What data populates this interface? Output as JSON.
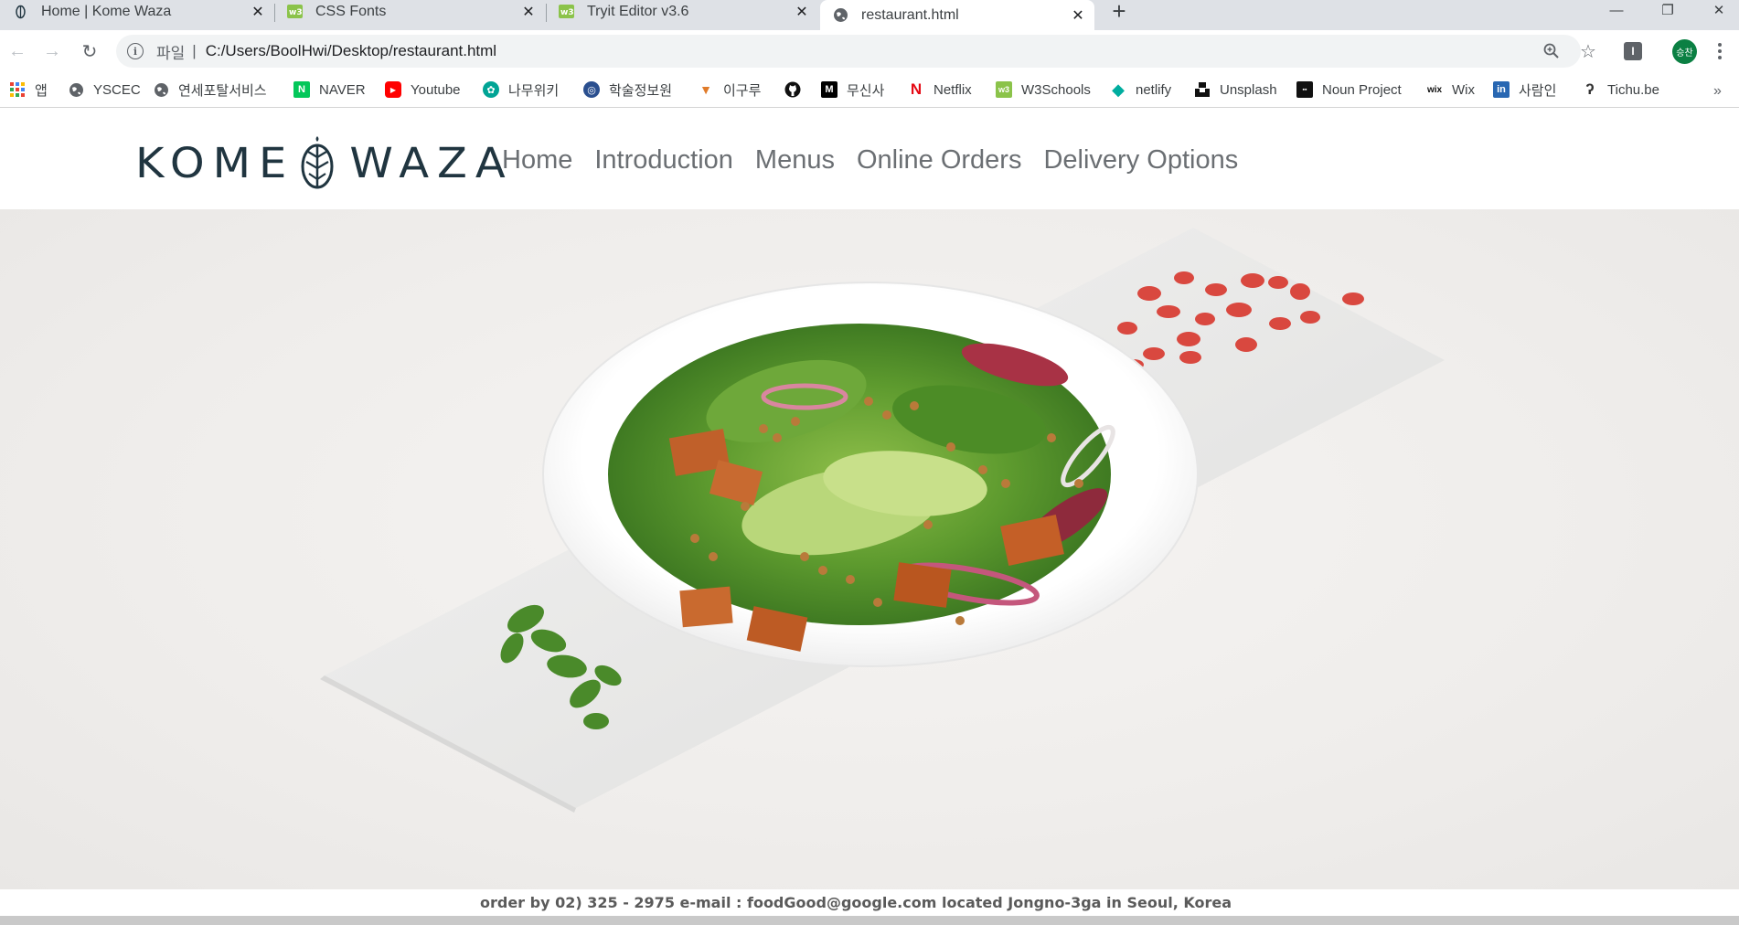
{
  "browser": {
    "tabs": [
      {
        "title": "Home | Kome Waza",
        "icon": "kome-waza-favicon",
        "active": false
      },
      {
        "title": "CSS Fonts",
        "icon": "w3schools-favicon",
        "active": false
      },
      {
        "title": "Tryit Editor v3.6",
        "icon": "w3schools-favicon",
        "active": false
      },
      {
        "title": "restaurant.html",
        "icon": "globe-icon",
        "active": true
      }
    ],
    "new_tab_label": "+",
    "window_controls": {
      "minimize": "—",
      "restore": "❐",
      "close": "✕"
    },
    "address": {
      "scheme_label": "파일",
      "url": "C:/Users/BoolHwi/Desktop/restaurant.html"
    },
    "profile_initials": "승찬",
    "extension_label": "I",
    "bookmarks": [
      {
        "label": "앱",
        "icon": "apps-grid-icon"
      },
      {
        "label": "YSCEC",
        "icon": "globe-icon"
      },
      {
        "label": "연세포탈서비스",
        "icon": "globe-icon"
      },
      {
        "label": "NAVER",
        "icon": "naver-icon",
        "glyph": "N",
        "color": "#03c75a"
      },
      {
        "label": "Youtube",
        "icon": "youtube-icon",
        "glyph": "▶",
        "color": "#ff0000"
      },
      {
        "label": "나무위키",
        "icon": "namuwiki-icon",
        "glyph": "✿",
        "color": "#00a495"
      },
      {
        "label": "학술정보원",
        "icon": "library-icon",
        "glyph": "◎",
        "color": "#2a4f8f"
      },
      {
        "label": "이구루",
        "icon": "pizza-icon",
        "glyph": "▼",
        "color": "#e07b2a"
      },
      {
        "label": "",
        "icon": "github-icon",
        "glyph": "●",
        "color": "#111111"
      },
      {
        "label": "무신사",
        "icon": "musinsa-icon",
        "glyph": "M",
        "color": "#000000"
      },
      {
        "label": "Netflix",
        "icon": "netflix-icon",
        "glyph": "N",
        "color": "#e50914"
      },
      {
        "label": "W3Schools",
        "icon": "w3schools-icon",
        "glyph": "w3",
        "color": "#8bc34a"
      },
      {
        "label": "netlify",
        "icon": "netlify-icon",
        "glyph": "◆",
        "color": "#00ad9f"
      },
      {
        "label": "Unsplash",
        "icon": "unsplash-icon",
        "glyph": "▟",
        "color": "#111111"
      },
      {
        "label": "Noun Project",
        "icon": "noun-project-icon",
        "glyph": "▪▪",
        "color": "#111111"
      },
      {
        "label": "Wix",
        "icon": "wix-icon",
        "glyph": "wix",
        "color": "#111111"
      },
      {
        "label": "사람인",
        "icon": "linkedin-icon",
        "glyph": "in",
        "color": "#2867b2"
      },
      {
        "label": "Tichu.be",
        "icon": "tichu-icon",
        "glyph": "ʔ",
        "color": "#333333"
      }
    ],
    "bookmarks_overflow": "»"
  },
  "site": {
    "logo_left": "KOME",
    "logo_right": "WAZA",
    "nav": [
      "Home",
      "Introduction",
      "Menus",
      "Online Orders",
      "Delivery Options"
    ],
    "hero_image": "salad-plate-photo",
    "footer": "order by 02) 325 - 2975 e-mail : foodGood@google.com located Jongno-3ga in Seoul, Korea"
  },
  "colors": {
    "logo": "#203540",
    "nav_text": "#6b6f73",
    "tab_strip": "#dee1e6",
    "omnibox": "#f1f3f4"
  }
}
